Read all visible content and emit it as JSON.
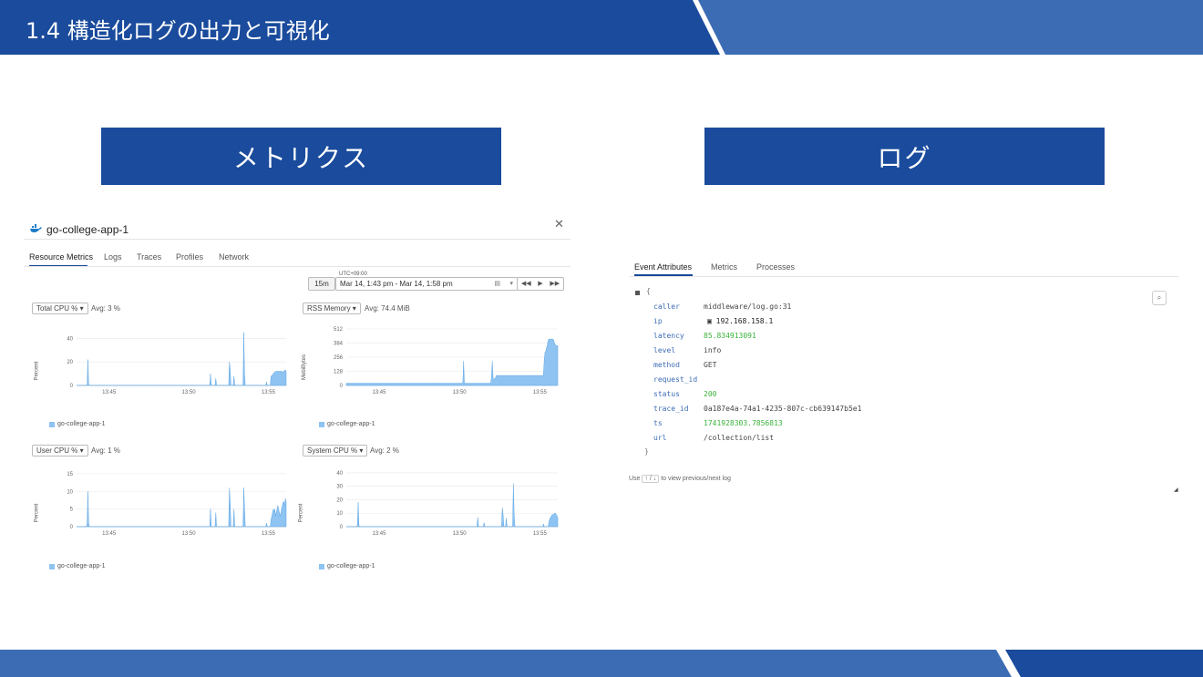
{
  "slide": {
    "title": "1.4 構造化ログの出力と可視化"
  },
  "sections": {
    "metrics_label": "メトリクス",
    "logs_label": "ログ"
  },
  "colors": {
    "primary": "#1A4B9C",
    "secondary": "#3C6CB4",
    "series": "#8EC3F2",
    "number": "#3BB33B"
  },
  "metrics": {
    "app_name": "go-college-app-1",
    "tabs": [
      "Resource Metrics",
      "Logs",
      "Traces",
      "Profiles",
      "Network"
    ],
    "active_tab": "Resource Metrics",
    "timezone": "UTC+09:00",
    "range_button": "15m",
    "time_range": "Mar 14, 1:43 pm - Mar 14, 1:58 pm",
    "charts": [
      {
        "select": "Total CPU %",
        "avg": "Avg: 3 %",
        "ylabel": "Percent",
        "legend": "go-college-app-1"
      },
      {
        "select": "RSS Memory",
        "avg": "Avg: 74.4 MiB",
        "ylabel": "MebiBytes",
        "legend": "go-college-app-1"
      },
      {
        "select": "User CPU %",
        "avg": "Avg: 1 %",
        "ylabel": "Percent",
        "legend": "go-college-app-1"
      },
      {
        "select": "System CPU %",
        "avg": "Avg: 2 %",
        "ylabel": "Percent",
        "legend": "go-college-app-1"
      }
    ]
  },
  "chart_data": [
    {
      "type": "area",
      "x_ticks": [
        "13:45",
        "13:50",
        "13:55"
      ],
      "y_ticks": [
        0,
        20,
        40
      ],
      "ylim": [
        0,
        48
      ],
      "values": [
        0,
        0,
        0,
        0,
        0,
        0,
        0,
        0,
        0,
        0,
        0,
        0,
        0,
        0,
        1,
        22,
        1,
        0,
        0,
        0,
        0,
        0,
        0,
        0,
        0,
        0,
        0,
        0,
        0,
        0,
        0,
        0,
        0,
        0,
        0,
        0,
        0,
        0,
        0,
        0,
        0,
        0,
        0,
        0,
        0,
        0,
        0,
        0,
        0,
        0,
        0,
        0,
        0,
        0,
        0,
        0,
        0,
        0,
        0,
        0,
        0,
        0,
        0,
        0,
        0,
        0,
        0,
        0,
        0,
        0,
        0,
        0,
        0,
        0,
        0,
        0,
        0,
        0,
        0,
        0,
        0,
        0,
        0,
        0,
        0,
        0,
        0,
        0,
        0,
        0,
        0,
        0,
        0,
        0,
        0,
        0,
        0,
        0,
        0,
        0,
        0,
        0,
        0,
        0,
        0,
        0,
        0,
        0,
        0,
        0,
        0,
        0,
        0,
        0,
        0,
        0,
        0,
        0,
        0,
        0,
        0,
        0,
        0,
        0,
        0,
        0,
        0,
        0,
        0,
        0,
        0,
        0,
        0,
        0,
        0,
        0,
        0,
        0,
        0,
        0,
        0,
        0,
        0,
        0,
        0,
        0,
        0,
        0,
        0,
        0,
        0,
        0,
        0,
        0,
        0,
        0,
        0,
        0,
        0,
        0,
        0,
        0,
        0,
        0,
        0,
        0,
        0,
        0,
        0,
        0,
        0,
        0,
        0,
        0,
        0,
        0,
        0,
        10,
        0,
        0,
        0,
        0,
        0,
        0,
        6,
        0,
        0,
        0,
        0,
        0,
        0,
        0,
        0,
        0,
        0,
        0,
        0,
        0,
        0,
        0,
        0,
        0,
        20,
        14,
        0,
        0,
        0,
        0,
        8,
        0,
        0,
        0,
        0,
        0,
        0,
        0,
        0,
        0,
        0,
        0,
        0,
        45,
        10,
        0,
        0,
        0,
        0,
        0,
        0,
        0,
        0,
        0,
        0,
        0,
        0,
        0,
        0,
        0,
        0,
        0,
        0,
        0,
        0,
        0,
        0,
        0,
        0,
        0,
        0,
        0,
        0,
        3,
        0,
        0,
        0,
        0,
        0,
        8,
        8,
        9,
        10,
        11,
        11,
        12,
        12,
        12,
        12,
        12,
        12,
        12,
        12,
        12,
        12,
        11,
        12,
        13,
        13,
        12
      ]
    },
    {
      "type": "area",
      "x_ticks": [
        "13:45",
        "13:50",
        "13:55"
      ],
      "y_ticks": [
        0,
        128,
        256,
        384,
        512
      ],
      "ylim": [
        0,
        512
      ],
      "values": [
        20,
        20,
        20,
        20,
        20,
        20,
        20,
        20,
        20,
        20,
        20,
        20,
        20,
        20,
        20,
        20,
        20,
        20,
        20,
        20,
        20,
        20,
        20,
        20,
        20,
        20,
        20,
        20,
        20,
        20,
        20,
        20,
        20,
        20,
        20,
        20,
        20,
        20,
        20,
        20,
        20,
        20,
        20,
        20,
        20,
        20,
        20,
        20,
        20,
        20,
        20,
        20,
        20,
        20,
        20,
        20,
        20,
        20,
        20,
        20,
        20,
        20,
        20,
        20,
        20,
        20,
        20,
        20,
        20,
        20,
        20,
        20,
        20,
        20,
        20,
        20,
        20,
        20,
        20,
        20,
        20,
        20,
        20,
        20,
        20,
        20,
        20,
        20,
        20,
        20,
        20,
        20,
        20,
        20,
        20,
        20,
        20,
        20,
        20,
        20,
        20,
        20,
        20,
        20,
        20,
        20,
        20,
        20,
        20,
        20,
        20,
        20,
        20,
        20,
        20,
        20,
        20,
        20,
        20,
        20,
        20,
        20,
        20,
        20,
        20,
        20,
        20,
        20,
        20,
        20,
        20,
        20,
        20,
        20,
        20,
        20,
        20,
        20,
        20,
        20,
        20,
        20,
        20,
        20,
        20,
        20,
        20,
        220,
        20,
        20,
        20,
        20,
        20,
        20,
        20,
        20,
        20,
        20,
        20,
        20,
        20,
        20,
        20,
        20,
        20,
        20,
        20,
        20,
        20,
        20,
        20,
        20,
        20,
        20,
        20,
        20,
        20,
        20,
        20,
        20,
        20,
        20,
        80,
        220,
        60,
        60,
        60,
        70,
        90,
        90,
        90,
        90,
        90,
        90,
        90,
        90,
        90,
        90,
        90,
        90,
        90,
        90,
        90,
        90,
        90,
        90,
        90,
        90,
        90,
        90,
        90,
        90,
        90,
        90,
        90,
        90,
        90,
        90,
        90,
        90,
        90,
        90,
        90,
        90,
        90,
        90,
        90,
        90,
        90,
        90,
        90,
        90,
        90,
        90,
        90,
        90,
        90,
        90,
        90,
        90,
        90,
        90,
        90,
        90,
        90,
        90,
        90,
        90,
        220,
        300,
        310,
        340,
        370,
        410,
        420,
        420,
        420,
        420,
        420,
        420,
        410,
        380,
        370,
        360,
        360,
        360
      ]
    },
    {
      "type": "area",
      "x_ticks": [
        "13:45",
        "13:50",
        "13:55"
      ],
      "y_ticks": [
        0,
        5,
        10,
        15
      ],
      "ylim": [
        0,
        16
      ],
      "values": [
        0,
        0,
        0,
        0,
        0,
        0,
        0,
        0,
        0,
        0,
        0,
        0,
        0,
        0,
        1,
        10,
        1,
        0,
        0,
        0,
        0,
        0,
        0,
        0,
        0,
        0,
        0,
        0,
        0,
        0,
        0,
        0,
        0,
        0,
        0,
        0,
        0,
        0,
        0,
        0,
        0,
        0,
        0,
        0,
        0,
        0,
        0,
        0,
        0,
        0,
        0,
        0,
        0,
        0,
        0,
        0,
        0,
        0,
        0,
        0,
        0,
        0,
        0,
        0,
        0,
        0,
        0,
        0,
        0,
        0,
        0,
        0,
        0,
        0,
        0,
        0,
        0,
        0,
        0,
        0,
        0,
        0,
        0,
        0,
        0,
        0,
        0,
        0,
        0,
        0,
        0,
        0,
        0,
        0,
        0,
        0,
        0,
        0,
        0,
        0,
        0,
        0,
        0,
        0,
        0,
        0,
        0,
        0,
        0,
        0,
        0,
        0,
        0,
        0,
        0,
        0,
        0,
        0,
        0,
        0,
        0,
        0,
        0,
        0,
        0,
        0,
        0,
        0,
        0,
        0,
        0,
        0,
        0,
        0,
        0,
        0,
        0,
        0,
        0,
        0,
        0,
        0,
        0,
        0,
        0,
        0,
        0,
        0,
        0,
        0,
        0,
        0,
        0,
        0,
        0,
        0,
        0,
        0,
        0,
        0,
        0,
        0,
        0,
        0,
        0,
        0,
        0,
        0,
        0,
        0,
        0,
        0,
        0,
        0,
        0,
        0,
        0,
        5,
        0,
        0,
        0,
        0,
        0,
        0,
        4,
        0,
        0,
        0,
        0,
        0,
        0,
        0,
        0,
        0,
        0,
        0,
        0,
        0,
        0,
        0,
        0,
        0,
        11,
        7,
        0,
        0,
        0,
        0,
        5,
        0,
        0,
        0,
        0,
        0,
        0,
        0,
        0,
        0,
        0,
        0,
        0,
        11,
        5,
        0,
        0,
        0,
        0,
        0,
        0,
        0,
        0,
        0,
        0,
        0,
        0,
        0,
        0,
        0,
        0,
        0,
        0,
        0,
        0,
        0,
        0,
        0,
        0,
        0,
        0,
        0,
        0,
        1,
        0,
        0,
        0,
        0,
        0,
        2,
        3,
        4,
        5,
        4,
        5,
        3,
        4,
        5,
        6,
        5,
        4,
        3,
        4,
        5,
        6,
        7,
        7,
        6,
        8,
        7
      ]
    },
    {
      "type": "area",
      "x_ticks": [
        "13:45",
        "13:50",
        "13:55"
      ],
      "y_ticks": [
        0,
        10,
        20,
        30,
        40
      ],
      "ylim": [
        0,
        42
      ],
      "values": [
        0,
        0,
        0,
        0,
        0,
        0,
        0,
        0,
        0,
        0,
        0,
        0,
        0,
        0,
        1,
        18,
        1,
        0,
        0,
        0,
        0,
        0,
        0,
        0,
        0,
        0,
        0,
        0,
        0,
        0,
        0,
        0,
        0,
        0,
        0,
        0,
        0,
        0,
        0,
        0,
        0,
        0,
        0,
        0,
        0,
        0,
        0,
        0,
        0,
        0,
        0,
        0,
        0,
        0,
        0,
        0,
        0,
        0,
        0,
        0,
        0,
        0,
        0,
        0,
        0,
        0,
        0,
        0,
        0,
        0,
        0,
        0,
        0,
        0,
        0,
        0,
        0,
        0,
        0,
        0,
        0,
        0,
        0,
        0,
        0,
        0,
        0,
        0,
        0,
        0,
        0,
        0,
        0,
        0,
        0,
        0,
        0,
        0,
        0,
        0,
        0,
        0,
        0,
        0,
        0,
        0,
        0,
        0,
        0,
        0,
        0,
        0,
        0,
        0,
        0,
        0,
        0,
        0,
        0,
        0,
        0,
        0,
        0,
        0,
        0,
        0,
        0,
        0,
        0,
        0,
        0,
        0,
        0,
        0,
        0,
        0,
        0,
        0,
        0,
        0,
        0,
        0,
        0,
        0,
        0,
        0,
        0,
        0,
        0,
        0,
        0,
        0,
        0,
        0,
        0,
        0,
        0,
        0,
        0,
        0,
        0,
        0,
        0,
        0,
        0,
        0,
        7,
        0,
        0,
        0,
        0,
        0,
        0,
        0,
        3,
        0,
        0,
        0,
        0,
        0,
        0,
        0,
        0,
        0,
        0,
        0,
        0,
        0,
        0,
        0,
        0,
        0,
        0,
        0,
        0,
        0,
        0,
        14,
        9,
        0,
        0,
        0,
        6,
        0,
        0,
        0,
        0,
        0,
        0,
        0,
        0,
        32,
        8,
        0,
        0,
        0,
        0,
        0,
        0,
        0,
        0,
        0,
        0,
        0,
        0,
        0,
        0,
        0,
        0,
        0,
        0,
        0,
        0,
        0,
        0,
        0,
        0,
        0,
        0,
        0,
        0,
        0,
        0,
        0,
        0,
        0,
        0,
        0,
        0,
        2,
        0,
        0,
        0,
        0,
        0,
        0,
        4,
        6,
        7,
        8,
        9,
        9,
        9,
        10,
        10,
        9,
        8,
        7
      ]
    }
  ],
  "log": {
    "tabs": [
      "Event Attributes",
      "Metrics",
      "Processes"
    ],
    "active_tab": "Event Attributes",
    "open_brace": "{",
    "close_brace": "}",
    "attributes": [
      {
        "key": "caller",
        "value": "middleware/log.go:31",
        "numeric": false
      },
      {
        "key": "ip",
        "value": "192.168.158.1",
        "numeric": false
      },
      {
        "key": "latency",
        "value": "85.834913091",
        "numeric": true
      },
      {
        "key": "level",
        "value": "info",
        "numeric": false
      },
      {
        "key": "method",
        "value": "GET",
        "numeric": false
      },
      {
        "key": "request_id",
        "value": "",
        "numeric": false
      },
      {
        "key": "status",
        "value": "200",
        "numeric": true
      },
      {
        "key": "trace_id",
        "value": "0a187e4a-74a1-4235-807c-cb639147b5e1",
        "numeric": false
      },
      {
        "key": "ts",
        "value": "1741928303.7856813",
        "numeric": true
      },
      {
        "key": "url",
        "value": "/collection/list",
        "numeric": false
      }
    ],
    "footer_use": "Use",
    "footer_keys": "↑ / ↓",
    "footer_hint": "to view previous/next log",
    "icons": {
      "search": "search-icon",
      "ip_badge": "ip-badge-icon",
      "collapse": "collapse-icon"
    }
  }
}
